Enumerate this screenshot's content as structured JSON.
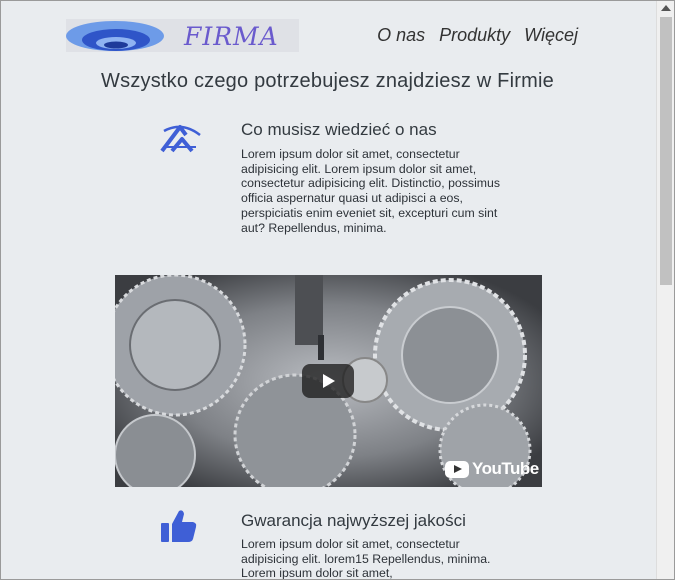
{
  "header": {
    "logo_text": "FIRMA",
    "nav": [
      "O nas",
      "Produkty",
      "Więcej"
    ]
  },
  "main": {
    "headline": "Wszystko czego potrzebujesz znajdziesz w Firmie",
    "features": [
      {
        "icon": "company-logo-icon",
        "title": "Co musisz wiedzieć o nas",
        "text": "Lorem ipsum dolor sit amet, consectetur adipisicing elit. Lorem ipsum dolor sit amet, consectetur adipisicing elit. Distinctio, possimus officia aspernatur quasi ut adipisci a eos, perspiciatis enim eveniet sit, excepturi cum sint aut? Repellendus, minima."
      },
      {
        "icon": "thumbs-up-icon",
        "title": "Gwarancja najwyższej jakości",
        "text": "Lorem ipsum dolor sit amet, consectetur adipisicing elit. lorem15 Repellendus, minima. Lorem ipsum dolor sit amet,"
      }
    ],
    "video": {
      "brand": "YouTube"
    }
  },
  "colors": {
    "background": "#e9ecef",
    "accent": "#3f5fd6",
    "logo_text": "#6a5acd"
  }
}
